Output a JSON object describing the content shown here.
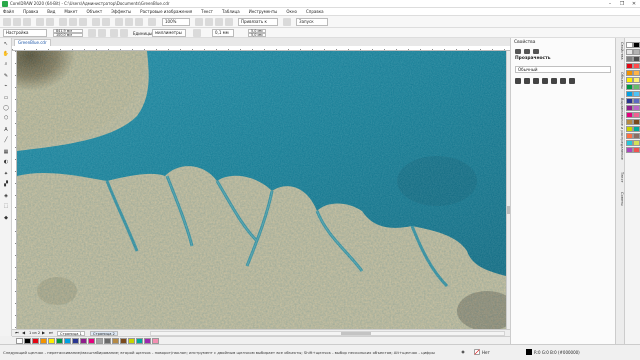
{
  "window": {
    "title": "CorelDRAW 2020 (64-Bit) - C:\\Users\\Администратор\\Documents\\GreenBlue.cdr",
    "controls": [
      "–",
      "❐",
      "✕"
    ]
  },
  "menu": [
    "Файл",
    "Правка",
    "Вид",
    "Макет",
    "Объект",
    "Эффекты",
    "Растровые изображения",
    "Текст",
    "Таблица",
    "Инструменты",
    "Окно",
    "Справка"
  ],
  "standard_toolbar": {
    "zoom": "100%",
    "snap": "Привязать к",
    "launch": "Запуск"
  },
  "property_bar": {
    "preset": "Настройка",
    "width": "841,9 мм",
    "height": "100,0 мм",
    "units_label": "Единицы:",
    "units": "миллиметры",
    "nudge": "0,1 мм",
    "dup_x": "5,0 мм",
    "dup_y": "5,0 мм"
  },
  "document_tab": "GreenBlue.cdr",
  "page_bar": {
    "current": "1 из 2",
    "pages": [
      "Страница 1",
      "Страница 2"
    ]
  },
  "docker": {
    "title": "Свойства",
    "section": "Прозрачность",
    "blend_mode": "Обычный"
  },
  "side_tabs": [
    "Свойства",
    "Объекты",
    "Выравнивание и распределение",
    "Текст",
    "Советы"
  ],
  "status": {
    "message": "Следующий щелчок - перетаскивание/масштабирование; второй щелчок - поворот/наклон; инструмент с двойным щелчком выбирает все объекты; Shift+щелчок - выбор нескольких объектов; Alt+щелчок - цифры",
    "fill_label": "Нет",
    "stroke_label": "R:0 G:0 B:0 (#000000)"
  },
  "palette_colors": [
    "#ffffff",
    "#000000",
    "#e30613",
    "#f39200",
    "#ffed00",
    "#009640",
    "#00a0e3",
    "#2a3590",
    "#8e1f8b",
    "#e5007e",
    "#a0a0a0",
    "#6b6b6b",
    "#b58a45",
    "#7a4a1e",
    "#c8d400",
    "#00a99d",
    "#9c27b0",
    "#f48fb1"
  ],
  "vpalette_colors": [
    "#ffffff",
    "#000000",
    "#e5e5e5",
    "#b3b3b3",
    "#808080",
    "#4d4d4d",
    "#e30613",
    "#ff4d4d",
    "#f39200",
    "#ffb347",
    "#ffed00",
    "#fff176",
    "#009640",
    "#66bb6a",
    "#00a0e3",
    "#4fc3f7",
    "#2a3590",
    "#5c6bc0",
    "#8e1f8b",
    "#ba68c8",
    "#e5007e",
    "#f06292",
    "#b58a45",
    "#7a4a1e",
    "#c8d400",
    "#00a99d",
    "#ff7043",
    "#8d6e63",
    "#26c6da",
    "#d4e157",
    "#ab47bc",
    "#ef5350"
  ],
  "tools": [
    "↖",
    "✋",
    "⌕",
    "✎",
    "⌁",
    "▭",
    "◯",
    "⬡",
    "A",
    "╱",
    "▦",
    "◐",
    "✦",
    "▞",
    "◈",
    "⬚",
    "◆"
  ]
}
